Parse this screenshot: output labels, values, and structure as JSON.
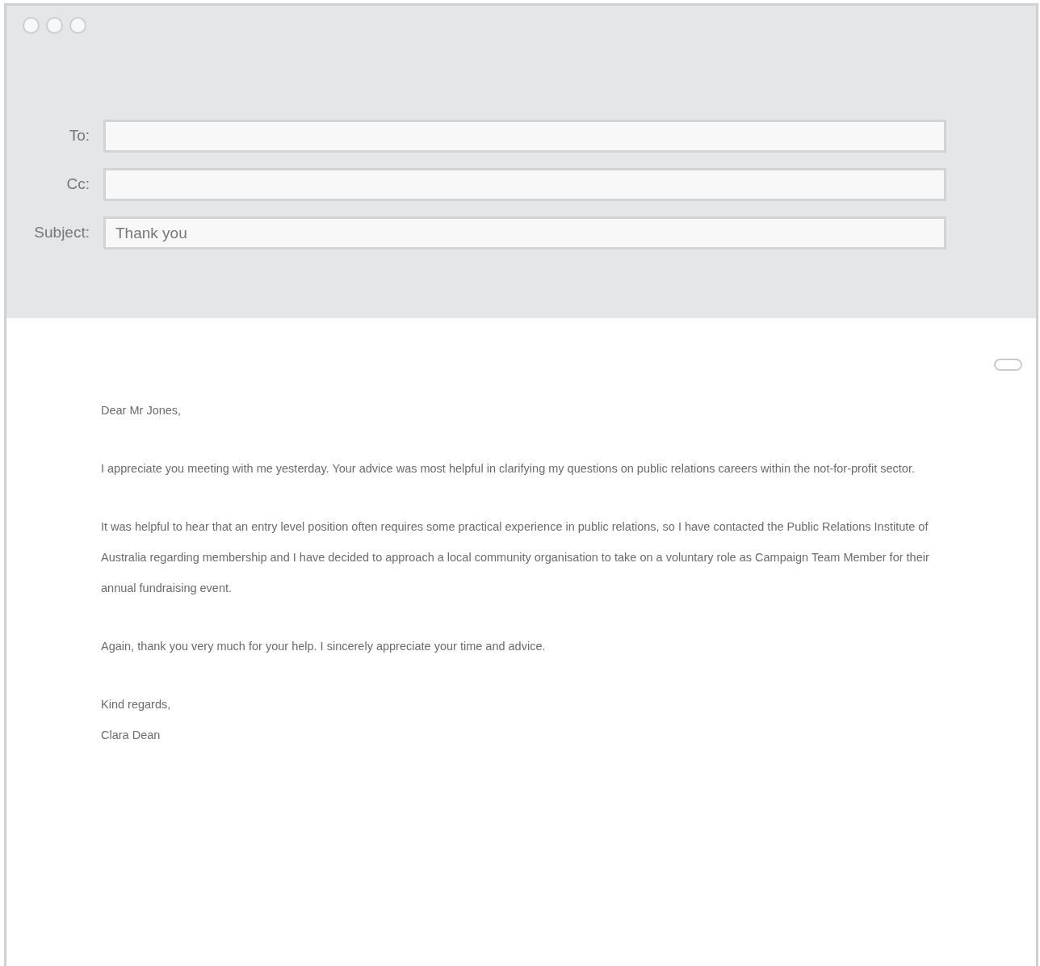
{
  "window": {
    "controls": [
      {
        "kind": "circle"
      },
      {
        "kind": "circle"
      },
      {
        "kind": "circle"
      }
    ]
  },
  "fields": [
    {
      "label": "To:"
    },
    {
      "label": "Cc:"
    },
    {
      "label": "Subject:",
      "value": "Thank you"
    }
  ],
  "body": {
    "paragraphs": [
      [
        "Dear Mr Jones,"
      ],
      [
        "I appreciate you meeting with me yesterday. Your advice was most helpful in clarifying my questions on public relations careers within the not-for-profit sector."
      ],
      [
        "It was helpful to hear that an entry level position often requires some practical experience in public relations, so I have contacted the Public Relations Institute of Australia regarding membership and I have decided to approach a local community organisation to take on a voluntary role as Campaign Team Member for their annual fundraising event."
      ],
      [
        "Again, thank you very much for your help. I sincerely appreciate your time and advice."
      ],
      [
        "Kind regards,",
        "Clara Dean"
      ]
    ]
  }
}
